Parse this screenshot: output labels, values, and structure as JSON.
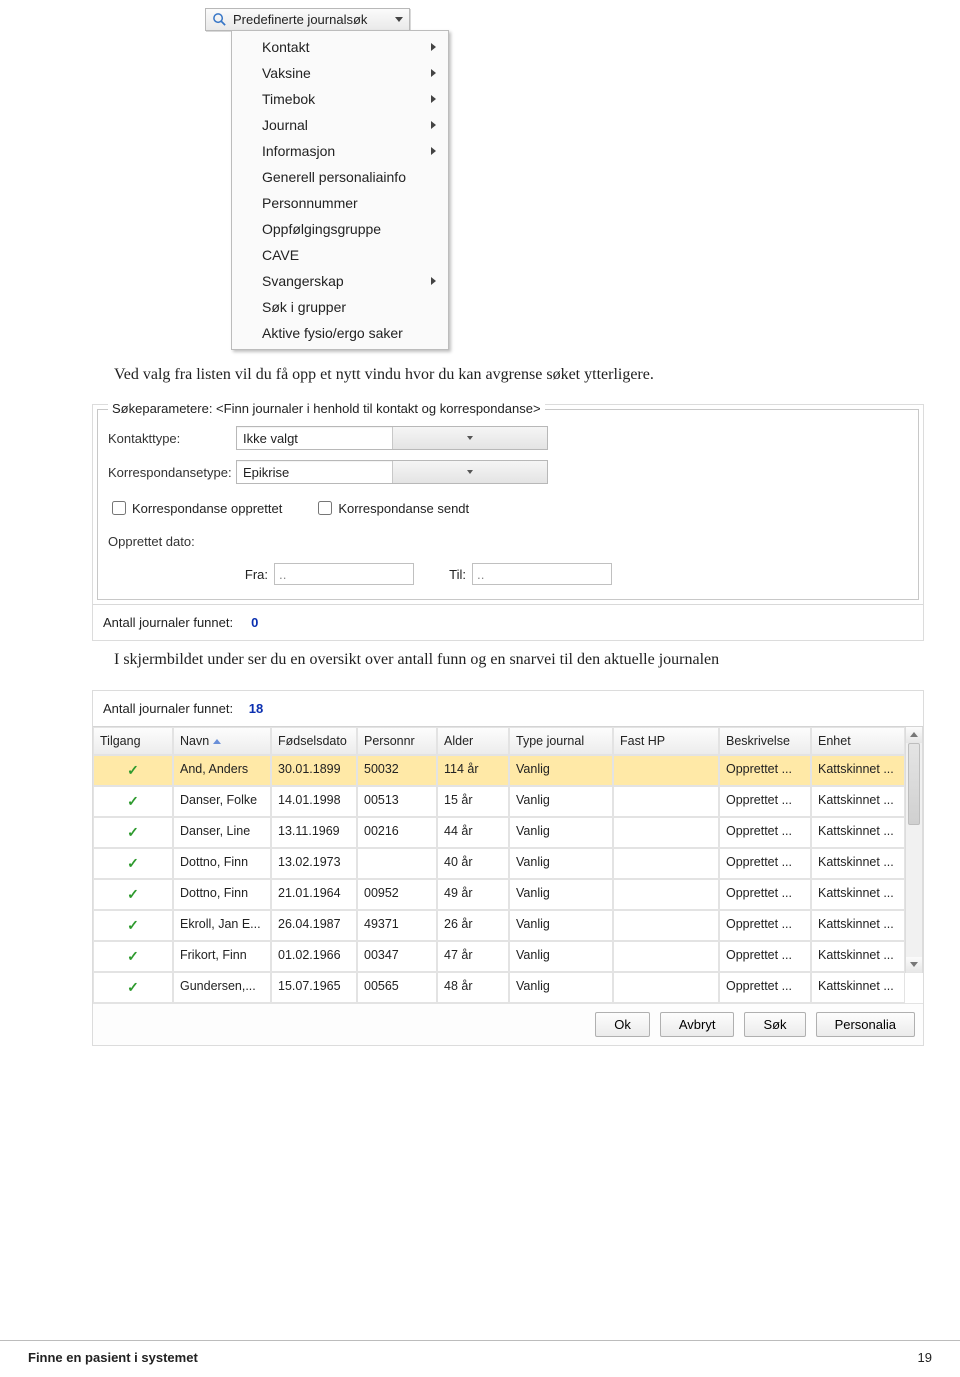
{
  "dropdown": {
    "button_label": "Predefinerte journalsøk",
    "items": [
      {
        "label": "Kontakt",
        "submenu": true
      },
      {
        "label": "Vaksine",
        "submenu": true
      },
      {
        "label": "Timebok",
        "submenu": true
      },
      {
        "label": "Journal",
        "submenu": true
      },
      {
        "label": "Informasjon",
        "submenu": true
      },
      {
        "label": "Generell personaliainfo",
        "submenu": false
      },
      {
        "label": "Personnummer",
        "submenu": false
      },
      {
        "label": "Oppfølgingsgruppe",
        "submenu": false
      },
      {
        "label": "CAVE",
        "submenu": false
      },
      {
        "label": "Svangerskap",
        "submenu": true
      },
      {
        "label": "Søk i grupper",
        "submenu": false
      },
      {
        "label": "Aktive fysio/ergo saker",
        "submenu": false
      }
    ]
  },
  "para1": "Ved valg fra listen vil du få opp et nytt vindu hvor du kan avgrense søket ytterligere.",
  "search_panel": {
    "legend": "Søkeparametere: <Finn journaler i henhold til kontakt og korrespondanse>",
    "kontakttype_label": "Kontakttype:",
    "kontakttype_value": "Ikke valgt",
    "korrtype_label": "Korrespondansetype:",
    "korrtype_value": "Epikrise",
    "chk_opprettet": "Korrespondanse opprettet",
    "chk_sendt": "Korrespondanse sendt",
    "opprettet_label": "Opprettet dato:",
    "fra_label": "Fra:",
    "fra_value": "..",
    "til_label": "Til:",
    "til_value": "..",
    "count_label": "Antall journaler funnet:",
    "count_value": "0"
  },
  "para2": "I skjermbildet under ser du en oversikt over antall funn og en snarvei til den aktuelle journalen",
  "results": {
    "count_label": "Antall journaler funnet:",
    "count_value": "18",
    "headers": [
      "Tilgang",
      "Navn",
      "Fødselsdato",
      "Personnr",
      "Alder",
      "Type journal",
      "Fast HP",
      "Beskrivelse",
      "Enhet"
    ],
    "rows": [
      {
        "sel": true,
        "tilgang": "✓",
        "navn": "And, Anders",
        "fdato": "30.01.1899",
        "pnr": "50032",
        "alder": "114 år",
        "type": "Vanlig",
        "hp": "",
        "besk": "Opprettet ...",
        "enhet": "Kattskinnet ..."
      },
      {
        "sel": false,
        "tilgang": "✓",
        "navn": "Danser, Folke",
        "fdato": "14.01.1998",
        "pnr": "00513",
        "alder": "15 år",
        "type": "Vanlig",
        "hp": "",
        "besk": "Opprettet ...",
        "enhet": "Kattskinnet ..."
      },
      {
        "sel": false,
        "tilgang": "✓",
        "navn": "Danser, Line",
        "fdato": "13.11.1969",
        "pnr": "00216",
        "alder": "44 år",
        "type": "Vanlig",
        "hp": "",
        "besk": "Opprettet ...",
        "enhet": "Kattskinnet ..."
      },
      {
        "sel": false,
        "tilgang": "✓",
        "navn": "Dottno, Finn",
        "fdato": "13.02.1973",
        "pnr": "",
        "alder": "40 år",
        "type": "Vanlig",
        "hp": "",
        "besk": "Opprettet ...",
        "enhet": "Kattskinnet ..."
      },
      {
        "sel": false,
        "tilgang": "✓",
        "navn": "Dottno, Finn",
        "fdato": "21.01.1964",
        "pnr": "00952",
        "alder": "49 år",
        "type": "Vanlig",
        "hp": "",
        "besk": "Opprettet ...",
        "enhet": "Kattskinnet ..."
      },
      {
        "sel": false,
        "tilgang": "✓",
        "navn": "Ekroll, Jan E...",
        "fdato": "26.04.1987",
        "pnr": "49371",
        "alder": "26 år",
        "type": "Vanlig",
        "hp": "",
        "besk": "Opprettet ...",
        "enhet": "Kattskinnet ..."
      },
      {
        "sel": false,
        "tilgang": "✓",
        "navn": "Frikort, Finn",
        "fdato": "01.02.1966",
        "pnr": "00347",
        "alder": "47 år",
        "type": "Vanlig",
        "hp": "",
        "besk": "Opprettet ...",
        "enhet": "Kattskinnet ..."
      },
      {
        "sel": false,
        "tilgang": "✓",
        "navn": "Gundersen,...",
        "fdato": "15.07.1965",
        "pnr": "00565",
        "alder": "48 år",
        "type": "Vanlig",
        "hp": "",
        "besk": "Opprettet ...",
        "enhet": "Kattskinnet ..."
      }
    ],
    "buttons": {
      "ok": "Ok",
      "cancel": "Avbryt",
      "search": "Søk",
      "personalia": "Personalia"
    }
  },
  "footer": {
    "title": "Finne en pasient i systemet",
    "page": "19"
  }
}
